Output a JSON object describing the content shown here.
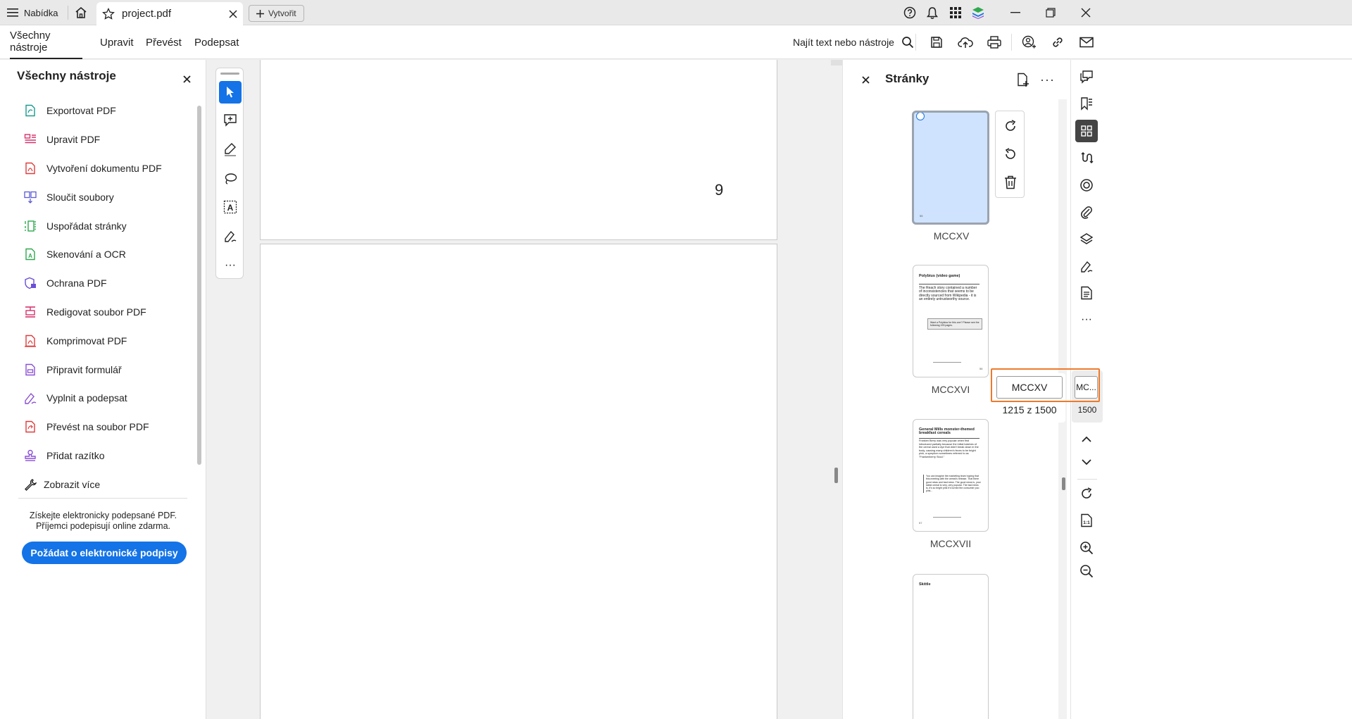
{
  "titlebar": {
    "menu_label": "Nabídka",
    "doc_tab_title": "project.pdf",
    "create_label": "Vytvořit"
  },
  "toolbar": {
    "tabs": [
      {
        "label": "Všechny nástroje",
        "active": true
      },
      {
        "label": "Upravit"
      },
      {
        "label": "Převést"
      },
      {
        "label": "Podepsat"
      }
    ],
    "find_label": "Najít text nebo nástroje"
  },
  "tools_panel": {
    "title": "Všechny nástroje",
    "items": [
      {
        "label": "Exportovat PDF",
        "icon": "export-pdf-icon",
        "color": "#1a9b8f"
      },
      {
        "label": "Upravit PDF",
        "icon": "edit-pdf-icon",
        "color": "#d6336c"
      },
      {
        "label": "Vytvoření dokumentu PDF",
        "icon": "create-pdf-icon",
        "color": "#e03b3b"
      },
      {
        "label": "Sloučit soubory",
        "icon": "combine-files-icon",
        "color": "#5b5bd6"
      },
      {
        "label": "Uspořádat stránky",
        "icon": "organize-pages-icon",
        "color": "#2fa84f"
      },
      {
        "label": "Skenování a OCR",
        "icon": "scan-ocr-icon",
        "color": "#2fa84f"
      },
      {
        "label": "Ochrana PDF",
        "icon": "protect-pdf-icon",
        "color": "#6a4fd6"
      },
      {
        "label": "Redigovat soubor PDF",
        "icon": "redact-pdf-icon",
        "color": "#d6336c"
      },
      {
        "label": "Komprimovat PDF",
        "icon": "compress-pdf-icon",
        "color": "#e03b3b"
      },
      {
        "label": "Připravit formulář",
        "icon": "prepare-form-icon",
        "color": "#8a4fd6"
      },
      {
        "label": "Vyplnit a podepsat",
        "icon": "fill-sign-icon",
        "color": "#8a4fd6"
      },
      {
        "label": "Převést na soubor PDF",
        "icon": "convert-pdf-icon",
        "color": "#e03b3b"
      },
      {
        "label": "Přidat razítko",
        "icon": "stamp-icon",
        "color": "#8a4fd6"
      },
      {
        "label": "Zobrazit více",
        "icon": "wrench-icon",
        "color": "#222222"
      }
    ],
    "promo_line1": "Získejte elektronicky podepsané PDF.",
    "promo_line2": "Příjemci podepisují online zdarma.",
    "promo_button": "Požádat o elektronické podpisy"
  },
  "document": {
    "visible_page_number": "9"
  },
  "pages_panel": {
    "title": "Stránky",
    "more": "···",
    "thumbnails": [
      {
        "label": "MCCXV",
        "selected": true,
        "footer": "55"
      },
      {
        "label": "MCCXVI",
        "heading": "Polybius (video game)",
        "body": "The Reach story contained a number of inconsistencies that seems to be directly sourced from Wikipedia - it is an entirely untrustworthy source.",
        "box": "Want a Polybius for this one? Please see the following 199 pages.",
        "footer": "56"
      },
      {
        "label": "MCCXVII",
        "heading": "General Mills monster-themed breakfast cereals",
        "body": "Franken Berry was very popular when first introduced partially because the initial batches of the cereal used a dye that didn't break down in the body, causing many children's feces to be bright pink, a symptom sometimes referred to as \"Frankenberry Stool.\"",
        "body2": "You can imagine the marketing team hoping that this meeting with the cereal's release. That there good news and bad news. The good news is, your latest cereal is very, very popular. The bad news is, it's so bright pink it's turned the consumer poo pink...",
        "footer": "57"
      },
      {
        "heading": "Skittle"
      }
    ]
  },
  "page_nav": {
    "input_value": "MCCXV",
    "of_text": "1215 z 1500",
    "rail_input_value": "MC...",
    "rail_total": "1500"
  },
  "colors": {
    "accent": "#1473e6",
    "highlight": "#ee7a2b",
    "selected_thumb": "#cfe3ff"
  }
}
